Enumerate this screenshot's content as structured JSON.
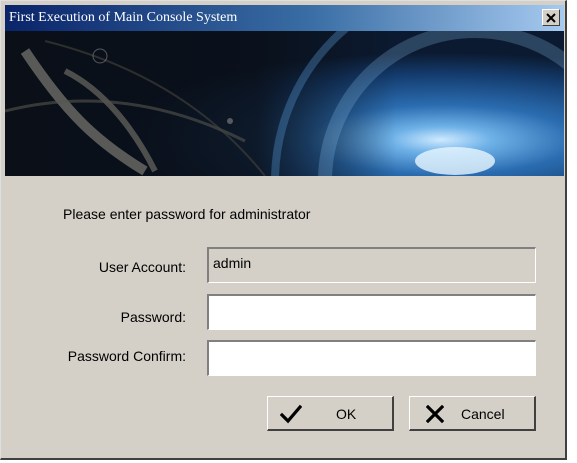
{
  "window": {
    "title": "First Execution of Main Console System",
    "close_glyph": "×"
  },
  "form": {
    "prompt": "Please enter password for administrator",
    "user_account_label": "User Account:",
    "user_account_value": "admin",
    "password_label": "Password:",
    "password_value": "",
    "password_confirm_label": "Password Confirm:",
    "password_confirm_value": ""
  },
  "buttons": {
    "ok_label": "OK",
    "ok_icon": "checkmark-icon",
    "cancel_label": "Cancel",
    "cancel_icon": "x-mark-icon"
  },
  "colors": {
    "titlebar_start": "#0a246a",
    "titlebar_end": "#a6caf0",
    "dialog_face": "#d4d0c8"
  }
}
